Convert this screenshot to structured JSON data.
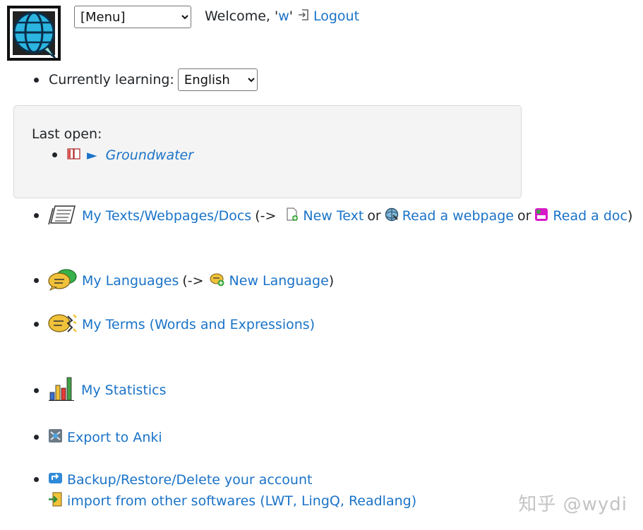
{
  "header": {
    "menu_select": "[Menu]",
    "welcome_prefix": "Welcome, '",
    "username": "w",
    "welcome_suffix": "'",
    "logout": "Logout"
  },
  "learning": {
    "label": "Currently learning:",
    "language": "English"
  },
  "last_open": {
    "label": "Last open:",
    "arrow": "►",
    "title": "Groundwater"
  },
  "items": {
    "texts": {
      "link": "My Texts/Webpages/Docs",
      "open": "(->",
      "new_text": "New Text",
      "or1": "or",
      "read_webpage": "Read a webpage",
      "or2": "or",
      "read_doc": "Read a doc",
      "close": ")"
    },
    "languages": {
      "link": "My Languages",
      "open": "(->",
      "new_language": "New Language",
      "close": ")"
    },
    "terms": {
      "link": "My Terms (Words and Expressions)"
    },
    "statistics": {
      "link": "My Statistics"
    },
    "anki": {
      "link": "Export to Anki"
    },
    "backup": {
      "link": "Backup/Restore/Delete your account"
    },
    "import": {
      "link": "import from other softwares (LWT, LingQ, Readlang)"
    }
  },
  "watermark": "知乎 @wydi",
  "colors": {
    "link": "#1a73c8",
    "text": "#212529",
    "box_bg": "#f4f4f4"
  }
}
